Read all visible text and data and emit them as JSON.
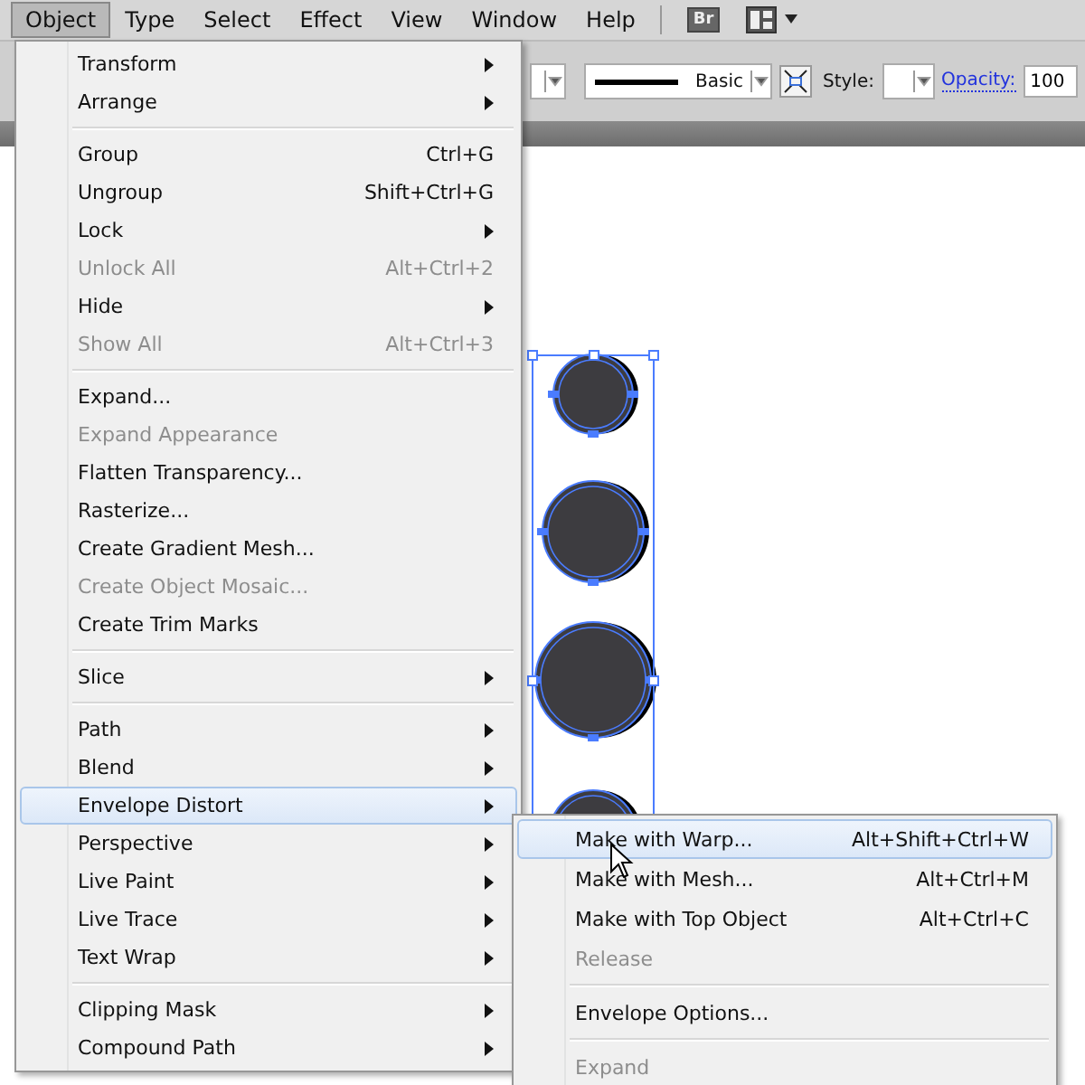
{
  "menu_bar": [
    {
      "label": "Object",
      "selected": true
    },
    {
      "label": "Type",
      "selected": false
    },
    {
      "label": "Select",
      "selected": false
    },
    {
      "label": "Effect",
      "selected": false
    },
    {
      "label": "View",
      "selected": false
    },
    {
      "label": "Window",
      "selected": false
    },
    {
      "label": "Help",
      "selected": false
    }
  ],
  "app_buttons": [
    {
      "label": "Br"
    }
  ],
  "control_bar": {
    "stroke_style": "Basic",
    "style_label": "Style:",
    "opacity_label": "Opacity:",
    "opacity_value": "100"
  },
  "object_menu": [
    {
      "kind": "item",
      "label": "Transform",
      "submenu": true,
      "disabled": false,
      "selected": false
    },
    {
      "kind": "item",
      "label": "Arrange",
      "submenu": true,
      "disabled": false,
      "selected": false
    },
    {
      "kind": "separator"
    },
    {
      "kind": "item",
      "label": "Group",
      "shortcut": "Ctrl+G",
      "disabled": false,
      "selected": false
    },
    {
      "kind": "item",
      "label": "Ungroup",
      "shortcut": "Shift+Ctrl+G",
      "disabled": false,
      "selected": false
    },
    {
      "kind": "item",
      "label": "Lock",
      "submenu": true,
      "disabled": false,
      "selected": false
    },
    {
      "kind": "item",
      "label": "Unlock All",
      "shortcut": "Alt+Ctrl+2",
      "disabled": true,
      "selected": false
    },
    {
      "kind": "item",
      "label": "Hide",
      "submenu": true,
      "disabled": false,
      "selected": false
    },
    {
      "kind": "item",
      "label": "Show All",
      "shortcut": "Alt+Ctrl+3",
      "disabled": true,
      "selected": false
    },
    {
      "kind": "separator"
    },
    {
      "kind": "item",
      "label": "Expand...",
      "disabled": false,
      "selected": false
    },
    {
      "kind": "item",
      "label": "Expand Appearance",
      "disabled": true,
      "selected": false
    },
    {
      "kind": "item",
      "label": "Flatten Transparency...",
      "disabled": false,
      "selected": false
    },
    {
      "kind": "item",
      "label": "Rasterize...",
      "disabled": false,
      "selected": false
    },
    {
      "kind": "item",
      "label": "Create Gradient Mesh...",
      "disabled": false,
      "selected": false
    },
    {
      "kind": "item",
      "label": "Create Object Mosaic...",
      "disabled": true,
      "selected": false
    },
    {
      "kind": "item",
      "label": "Create Trim Marks",
      "disabled": false,
      "selected": false
    },
    {
      "kind": "separator"
    },
    {
      "kind": "item",
      "label": "Slice",
      "submenu": true,
      "disabled": false,
      "selected": false
    },
    {
      "kind": "separator"
    },
    {
      "kind": "item",
      "label": "Path",
      "submenu": true,
      "disabled": false,
      "selected": false
    },
    {
      "kind": "item",
      "label": "Blend",
      "submenu": true,
      "disabled": false,
      "selected": false
    },
    {
      "kind": "item",
      "label": "Envelope Distort",
      "submenu": true,
      "disabled": false,
      "selected": true
    },
    {
      "kind": "item",
      "label": "Perspective",
      "submenu": true,
      "disabled": false,
      "selected": false
    },
    {
      "kind": "item",
      "label": "Live Paint",
      "submenu": true,
      "disabled": false,
      "selected": false
    },
    {
      "kind": "item",
      "label": "Live Trace",
      "submenu": true,
      "disabled": false,
      "selected": false
    },
    {
      "kind": "item",
      "label": "Text Wrap",
      "submenu": true,
      "disabled": false,
      "selected": false
    },
    {
      "kind": "separator"
    },
    {
      "kind": "item",
      "label": "Clipping Mask",
      "submenu": true,
      "disabled": false,
      "selected": false
    },
    {
      "kind": "item",
      "label": "Compound Path",
      "submenu": true,
      "disabled": false,
      "selected": false
    }
  ],
  "envelope_submenu": [
    {
      "kind": "item",
      "label": "Make with Warp...",
      "shortcut": "Alt+Shift+Ctrl+W",
      "disabled": false,
      "selected": true
    },
    {
      "kind": "item",
      "label": "Make with Mesh...",
      "shortcut": "Alt+Ctrl+M",
      "disabled": false,
      "selected": false
    },
    {
      "kind": "item",
      "label": "Make with Top Object",
      "shortcut": "Alt+Ctrl+C",
      "disabled": false,
      "selected": false
    },
    {
      "kind": "item",
      "label": "Release",
      "disabled": true,
      "selected": false
    },
    {
      "kind": "separator"
    },
    {
      "kind": "item",
      "label": "Envelope Options...",
      "disabled": false,
      "selected": false
    },
    {
      "kind": "separator"
    },
    {
      "kind": "item",
      "label": "Expand",
      "disabled": true,
      "selected": false
    }
  ]
}
